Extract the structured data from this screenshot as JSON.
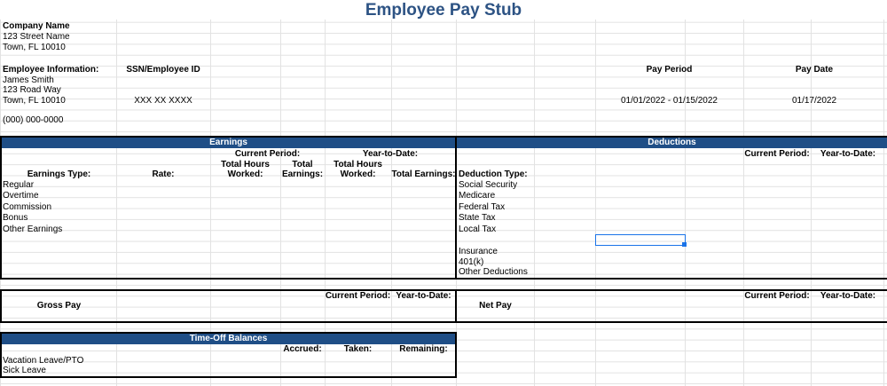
{
  "title": "Employee Pay Stub",
  "company": {
    "name_label": "Company Name",
    "street": "123 Street Name",
    "city": "Town, FL 10010"
  },
  "employee": {
    "section_label": "Employee Information:",
    "name": "James Smith",
    "street": "123 Road Way",
    "city": "Town, FL 10010",
    "phone": "(000) 000-0000",
    "ssn_label": "SSN/Employee ID",
    "ssn_value": "XXX XX XXXX"
  },
  "pay_period": {
    "label": "Pay Period",
    "value": "01/01/2022 - 01/15/2022"
  },
  "pay_date": {
    "label": "Pay Date",
    "value": "01/17/2022"
  },
  "earnings": {
    "banner": "Earnings",
    "current_period": "Current Period:",
    "year_to_date": "Year-to-Date:",
    "col_type": "Earnings Type:",
    "col_rate": "Rate:",
    "col_hours1": "Total Hours",
    "col_hours2": "Worked:",
    "col_total1": "Total",
    "col_total2": "Earnings:",
    "col_ytd_hours1": "Total Hours",
    "col_ytd_hours2": "Worked:",
    "col_ytd_total": "Total Earnings:",
    "rows": [
      "Regular",
      "Overtime",
      "Commission",
      "Bonus",
      "Other Earnings"
    ]
  },
  "deductions": {
    "banner": "Deductions",
    "current_period": "Current Period:",
    "year_to_date": "Year-to-Date:",
    "col_type": "Deduction Type:",
    "rows": [
      "Social Security",
      "Medicare",
      "Federal Tax",
      "State Tax",
      "Local Tax"
    ],
    "rows2": [
      "Insurance",
      "401(k)",
      "Other Deductions"
    ]
  },
  "gross": {
    "label": "Gross Pay",
    "current_period": "Current Period:",
    "year_to_date": "Year-to-Date:"
  },
  "net": {
    "label": "Net Pay",
    "current_period": "Current Period:",
    "year_to_date": "Year-to-Date:"
  },
  "timeoff": {
    "banner": "Time-Off Balances",
    "col_accrued": "Accrued:",
    "col_taken": "Taken:",
    "col_remaining": "Remaining:",
    "rows": [
      "Vacation Leave/PTO",
      "Sick Leave"
    ]
  }
}
